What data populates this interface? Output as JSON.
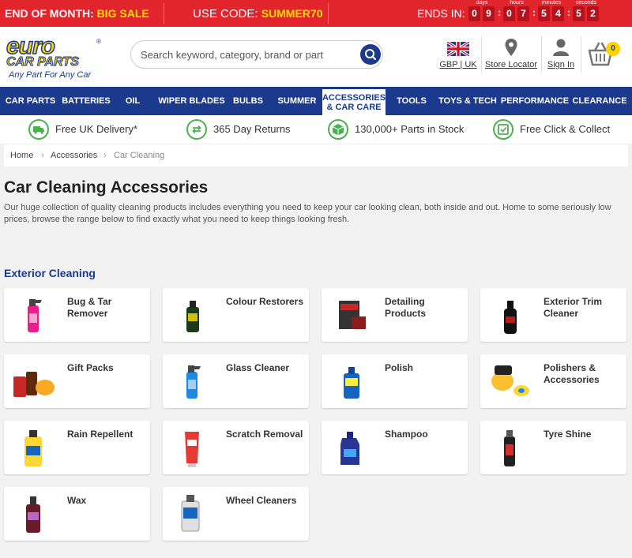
{
  "promo": {
    "left_prefix": "END OF MONTH: ",
    "left_highlight": "BIG SALE",
    "code_prefix": "USE CODE: ",
    "code": "SUMMER70",
    "ends_label": "ENDS IN:",
    "timer": [
      {
        "label": "days",
        "d1": "0",
        "d2": "9"
      },
      {
        "label": "hours",
        "d1": "0",
        "d2": "7"
      },
      {
        "label": "minutes",
        "d1": "5",
        "d2": "4"
      },
      {
        "label": "seconds",
        "d1": "5",
        "d2": "2"
      }
    ]
  },
  "header": {
    "logo_line1": "euro",
    "logo_line2": "CAR PARTS",
    "logo_tagline": "Any Part For Any Car",
    "logo_reg": "®",
    "search_placeholder": "Search keyword, category, brand or part",
    "currency": "GBP | UK",
    "store_locator": "Store Locator",
    "sign_in": "Sign In",
    "cart_count": "0"
  },
  "nav": {
    "items": [
      "CAR PARTS",
      "BATTERIES",
      "OIL",
      "WIPER BLADES",
      "BULBS",
      "SUMMER",
      "ACCESSORIES & CAR CARE",
      "TOOLS",
      "TOYS & TECH",
      "PERFORMANCE",
      "CLEARANCE"
    ]
  },
  "usp": [
    "Free UK Delivery*",
    "365 Day Returns",
    "130,000+ Parts in Stock",
    "Free Click & Collect"
  ],
  "breadcrumb": [
    "Home",
    "Accessories",
    "Car Cleaning"
  ],
  "page": {
    "title": "Car Cleaning Accessories",
    "description": "Our huge collection of quality cleaning products includes everything you need to keep your car looking clean, both inside and out. Home to some seriously low prices, browse the range below to find exactly what you need to keep things looking fresh.",
    "section": "Exterior Cleaning"
  },
  "categories": [
    "Bug & Tar Remover",
    "Colour Restorers",
    "Detailing Products",
    "Exterior Trim Cleaner",
    "Gift Packs",
    "Glass Cleaner",
    "Polish",
    "Polishers & Accessories",
    "Rain Repellent",
    "Scratch Removal",
    "Shampoo",
    "Tyre Shine",
    "Wax",
    "Wheel Cleaners"
  ],
  "colors": {
    "promo_red": "#e2252d",
    "brand_blue": "#1b3a8e",
    "brand_yellow": "#ffd200",
    "usp_green": "#4caf50"
  }
}
